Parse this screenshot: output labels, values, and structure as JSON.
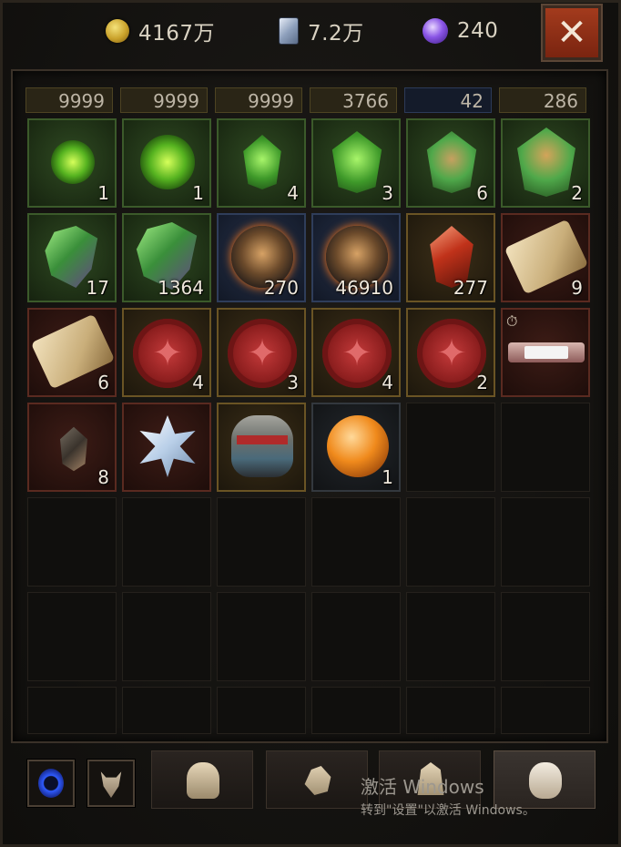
{
  "currencies": [
    {
      "name": "gold",
      "icon": "gold-coin-icon",
      "value": "4167万"
    },
    {
      "name": "crystal",
      "icon": "crystal-card-icon",
      "value": "7.2万"
    },
    {
      "name": "orb",
      "icon": "purple-orb-icon",
      "value": "240"
    }
  ],
  "close_label": "✕",
  "partial_row": [
    "9999",
    "9999",
    "9999",
    "3766",
    "42",
    "286"
  ],
  "rows": [
    [
      {
        "icon": "green-orb-small-icon",
        "count": "1",
        "rarity": "green"
      },
      {
        "icon": "green-orb-icon",
        "count": "1",
        "rarity": "green"
      },
      {
        "icon": "green-rune-icon",
        "count": "4",
        "rarity": "green"
      },
      {
        "icon": "green-rune-large-icon",
        "count": "3",
        "rarity": "green"
      },
      {
        "icon": "green-crest-icon",
        "count": "6",
        "rarity": "green"
      },
      {
        "icon": "green-crest-large-icon",
        "count": "2",
        "rarity": "green"
      }
    ],
    [
      {
        "icon": "green-shard-icon",
        "count": "17",
        "rarity": "green"
      },
      {
        "icon": "green-shard-large-icon",
        "count": "1364",
        "rarity": "green"
      },
      {
        "icon": "bronze-medal-icon",
        "count": "270",
        "rarity": "blue"
      },
      {
        "icon": "bronze-medal-icon",
        "count": "46910",
        "rarity": "blue"
      },
      {
        "icon": "ruby-gem-icon",
        "count": "277",
        "rarity": "gold"
      },
      {
        "icon": "map-scroll-icon",
        "count": "9",
        "rarity": "red"
      }
    ],
    [
      {
        "icon": "map-scroll-icon",
        "count": "6",
        "rarity": "red"
      },
      {
        "icon": "red-seal-icon",
        "count": "4",
        "rarity": "gold"
      },
      {
        "icon": "red-seal-icon",
        "count": "3",
        "rarity": "gold"
      },
      {
        "icon": "red-seal-icon",
        "count": "4",
        "rarity": "gold"
      },
      {
        "icon": "red-seal-icon",
        "count": "2",
        "rarity": "gold"
      },
      {
        "icon": "timed-banner-icon",
        "count": "",
        "rarity": "red"
      }
    ],
    [
      {
        "icon": "dark-gem-icon",
        "count": "8",
        "rarity": "red"
      },
      {
        "icon": "crystal-flower-icon",
        "count": "",
        "rarity": "red"
      },
      {
        "icon": "helm-mask-icon",
        "count": "",
        "rarity": "gold"
      },
      {
        "icon": "fire-orb-icon",
        "count": "1",
        "rarity": "dark"
      }
    ]
  ],
  "bottom_tabs": [
    {
      "name": "ring-tab",
      "icon": "blue-ring-icon"
    },
    {
      "name": "bull-tab",
      "icon": "bull-head-icon"
    },
    {
      "name": "helmet-tab",
      "icon": "helmet-icon"
    },
    {
      "name": "gloves-tab",
      "icon": "hand-icon"
    },
    {
      "name": "cloak-tab",
      "icon": "cloak-icon"
    },
    {
      "name": "bag-tab",
      "icon": "bag-icon",
      "active": true
    }
  ],
  "watermark": {
    "line1": "激活 Windows",
    "line2": "转到\"设置\"以激活 Windows。"
  }
}
